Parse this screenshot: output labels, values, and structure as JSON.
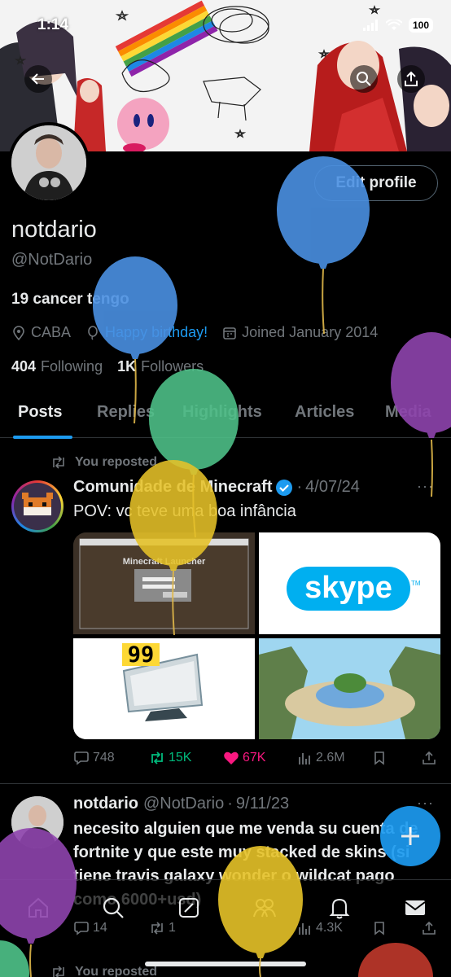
{
  "status_bar": {
    "time": "1:14",
    "battery": "100"
  },
  "profile": {
    "edit_label": "Edit profile",
    "display_name": "notdario",
    "handle": "@NotDario",
    "bio": "19 cancer tengo",
    "location": "CABA",
    "birthday": "Happy birthday!",
    "joined": "Joined January 2014",
    "following_count": "404",
    "following_label": "Following",
    "followers_count": "1K",
    "followers_label": "Followers"
  },
  "tabs": [
    {
      "label": "Posts",
      "active": true
    },
    {
      "label": "Replies"
    },
    {
      "label": "Highlights"
    },
    {
      "label": "Articles"
    },
    {
      "label": "Media"
    }
  ],
  "posts": [
    {
      "repost_label": "You reposted",
      "author": "Comunidade de Minecraft",
      "verified": true,
      "date": "4/07/24",
      "text": "POV: vc teve uma boa infância",
      "media": {
        "launcher_title": "Minecraft Launcher",
        "skype_text": "skype",
        "tm": "TM",
        "win_badge": "99"
      },
      "stats": {
        "replies": "748",
        "reposts": "15K",
        "likes": "67K",
        "views": "2.6M"
      }
    },
    {
      "author": "notdario",
      "handle": "@NotDario",
      "date": "9/11/23",
      "text": "necesito alguien que me venda su cuenta de fortnite y que este muy stacked de skins (si tiene travis galaxy wonder o wildcat pago como 6000+usd)",
      "stats": {
        "replies": "14",
        "reposts": "1",
        "likes": "",
        "views": "4.3K"
      }
    }
  ],
  "next_repost_label": "You reposted",
  "colors": {
    "accent": "#1d9bf0",
    "repost": "#00ba7c",
    "like": "#f91880",
    "muted": "#71767b"
  },
  "icons": [
    "back-arrow-icon",
    "search-icon",
    "share-icon",
    "location-icon",
    "balloon-icon",
    "calendar-icon",
    "repost-icon",
    "verified-icon",
    "reply-icon",
    "heart-icon",
    "views-icon",
    "bookmark-icon",
    "compose-icon",
    "home-icon",
    "grok-icon",
    "communities-icon",
    "bell-icon",
    "mail-icon"
  ]
}
